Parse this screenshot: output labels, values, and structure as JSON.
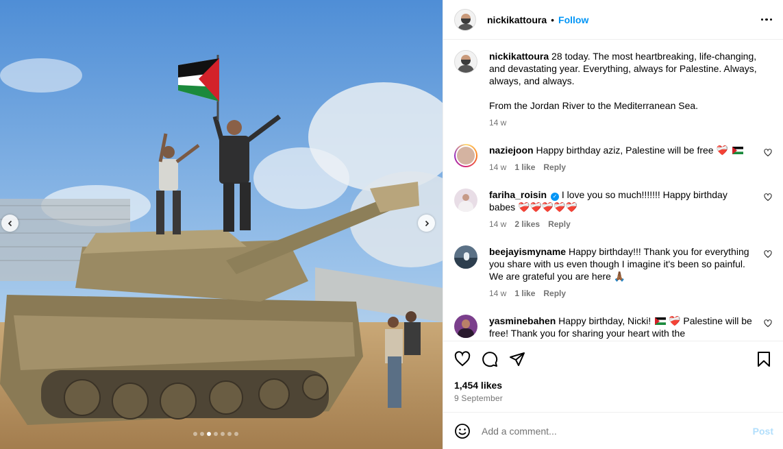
{
  "header": {
    "username": "nickikattoura",
    "separator": "•",
    "follow_label": "Follow"
  },
  "caption": {
    "username": "nickikattoura",
    "text": "28 today. The most heartbreaking, life-changing, and devastating year. Everything, always for Palestine. Always, always, and always.",
    "text2": "From the Jordan River to the Mediterranean Sea.",
    "time": "14 w"
  },
  "comments": [
    {
      "username": "naziejoon",
      "text": "Happy birthday aziz, Palestine will be free",
      "emoji": "❤️‍🩹",
      "time": "14 w",
      "likes": "1 like",
      "reply": "Reply"
    },
    {
      "username": "fariha_roisin",
      "text": "I love you so much!!!!!!! Happy birthday babes",
      "emoji": "❤️‍🩹❤️‍🩹❤️‍🩹❤️‍🩹❤️‍🩹",
      "time": "14 w",
      "likes": "2 likes",
      "reply": "Reply"
    },
    {
      "username": "beejayismyname",
      "text": "Happy birthday!!! Thank you for everything you share with us even though I imagine it's been so painful. We are grateful you are here",
      "emoji": "🙏🏾",
      "time": "14 w",
      "likes": "1 like",
      "reply": "Reply"
    },
    {
      "username": "yasminebahen",
      "text_a": "Happy birthday, Nicki!",
      "text_b": "Palestine will be free! Thank you for sharing your heart with the",
      "emoji": "❤️‍🩹"
    }
  ],
  "stats": {
    "likes": "1,454 likes",
    "date": "9 September"
  },
  "composer": {
    "placeholder": "Add a comment...",
    "post_label": "Post"
  },
  "colors": {
    "link_blue": "#0095f6",
    "post_disabled": "#b2dffc",
    "meta_grey": "#737373"
  },
  "carousel": {
    "slide_count": 7,
    "active_slide": 2
  }
}
